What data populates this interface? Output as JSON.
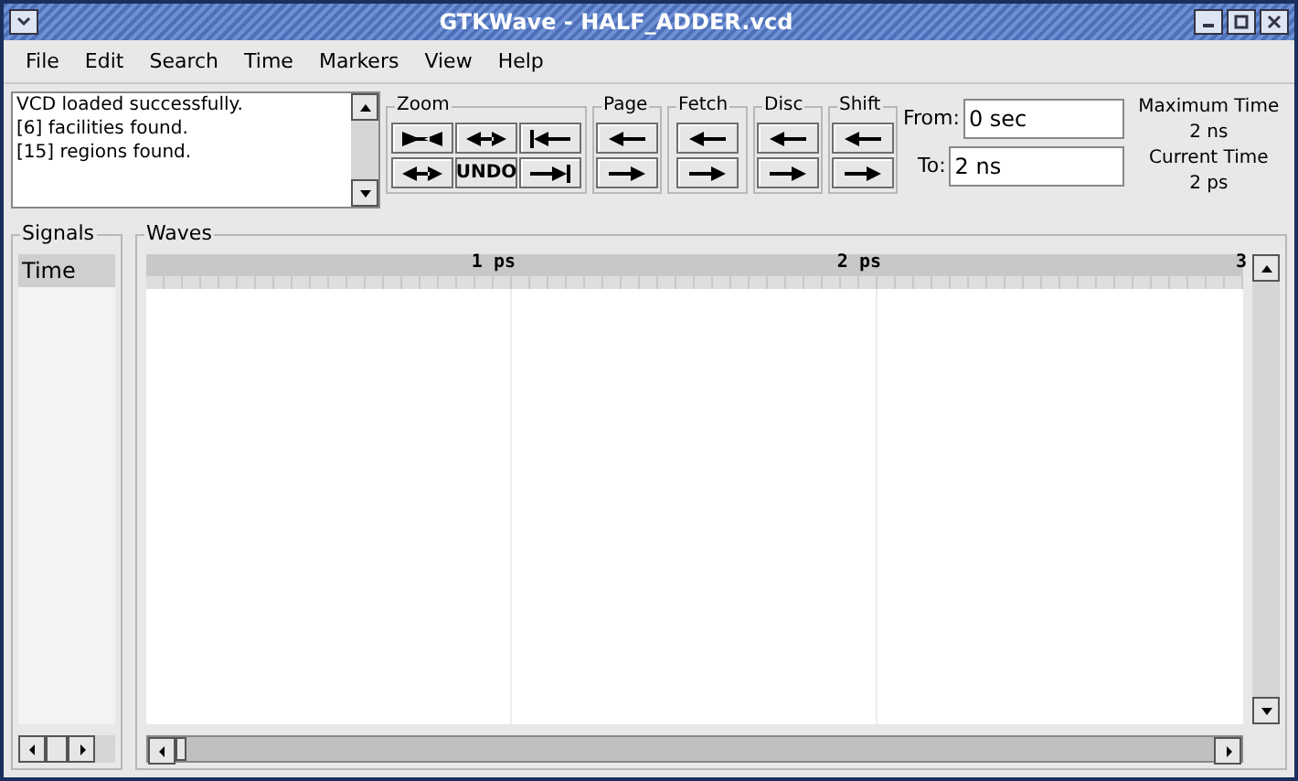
{
  "window": {
    "title": "GTKWave - HALF_ADDER.vcd"
  },
  "menu": [
    "File",
    "Edit",
    "Search",
    "Time",
    "Markers",
    "View",
    "Help"
  ],
  "log": [
    "VCD loaded successfully.",
    "[6] facilities found.",
    "[15] regions found."
  ],
  "zoom": {
    "label": "Zoom",
    "undo": "UNDO"
  },
  "nav_groups": [
    {
      "label": "Page"
    },
    {
      "label": "Fetch"
    },
    {
      "label": "Disc"
    },
    {
      "label": "Shift"
    }
  ],
  "from": {
    "label": "From:",
    "value": "0 sec"
  },
  "to": {
    "label": "To:",
    "value": "2 ns"
  },
  "max_time": {
    "label": "Maximum Time",
    "value": "2 ns"
  },
  "current_time": {
    "label": "Current Time",
    "value": "2 ps"
  },
  "signals": {
    "title": "Signals",
    "items": [
      "Time"
    ]
  },
  "waves": {
    "title": "Waves",
    "ticks": [
      "1 ps",
      "2 ps",
      "3"
    ]
  }
}
